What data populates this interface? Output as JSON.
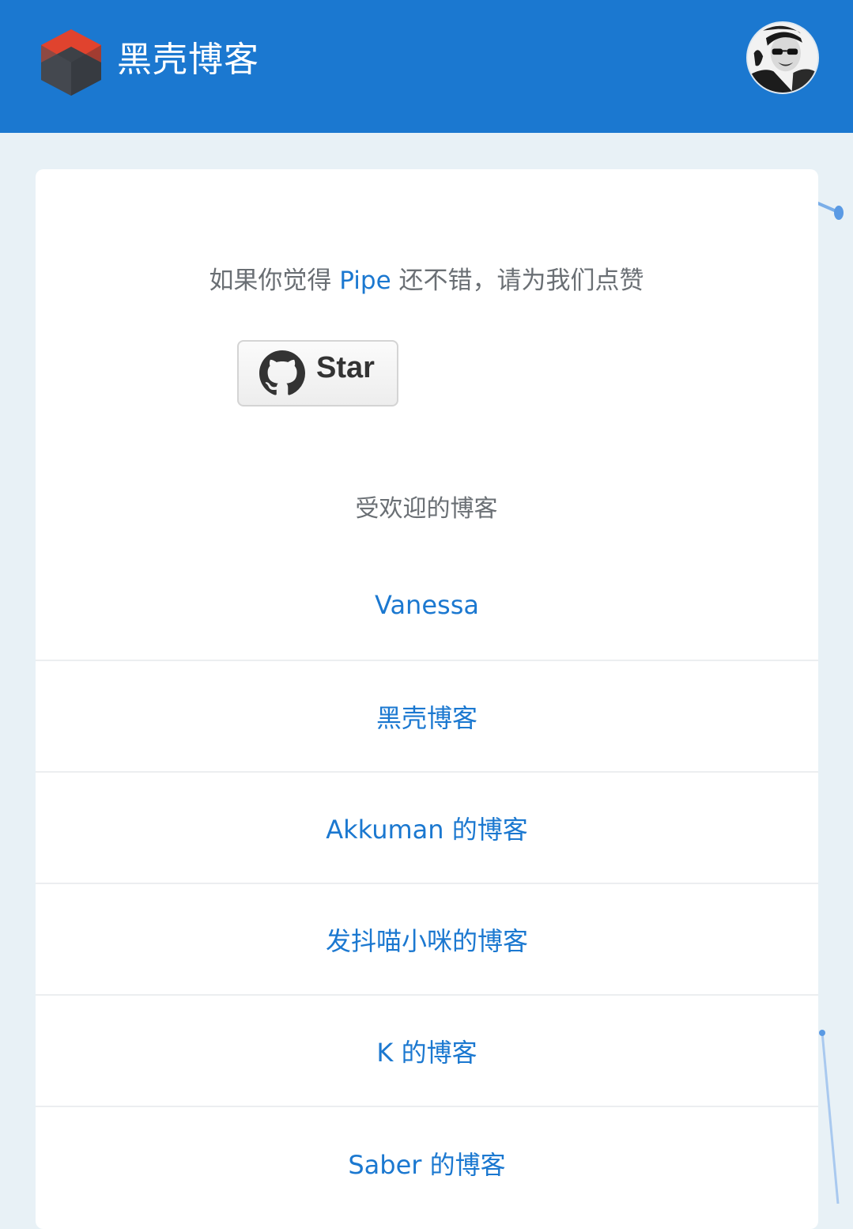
{
  "header": {
    "site_title": "黑壳博客",
    "logo_icon": "cube-logo-icon",
    "avatar_icon": "user-avatar"
  },
  "promo": {
    "text_before": "如果你觉得 ",
    "highlight": "Pipe",
    "text_after": " 还不错，请为我们点赞"
  },
  "star_button": {
    "label": "Star",
    "icon": "github-icon"
  },
  "popular": {
    "title": "受欢迎的博客",
    "items": [
      "Vanessa",
      "黑壳博客",
      "Akkuman 的博客",
      "发抖喵小咪的博客",
      "K 的博客",
      "Saber 的博客"
    ]
  },
  "colors": {
    "header": "#1b78d0",
    "link": "#1b78d0",
    "background": "#e8f1f6",
    "muted_text": "#6a6f74"
  }
}
